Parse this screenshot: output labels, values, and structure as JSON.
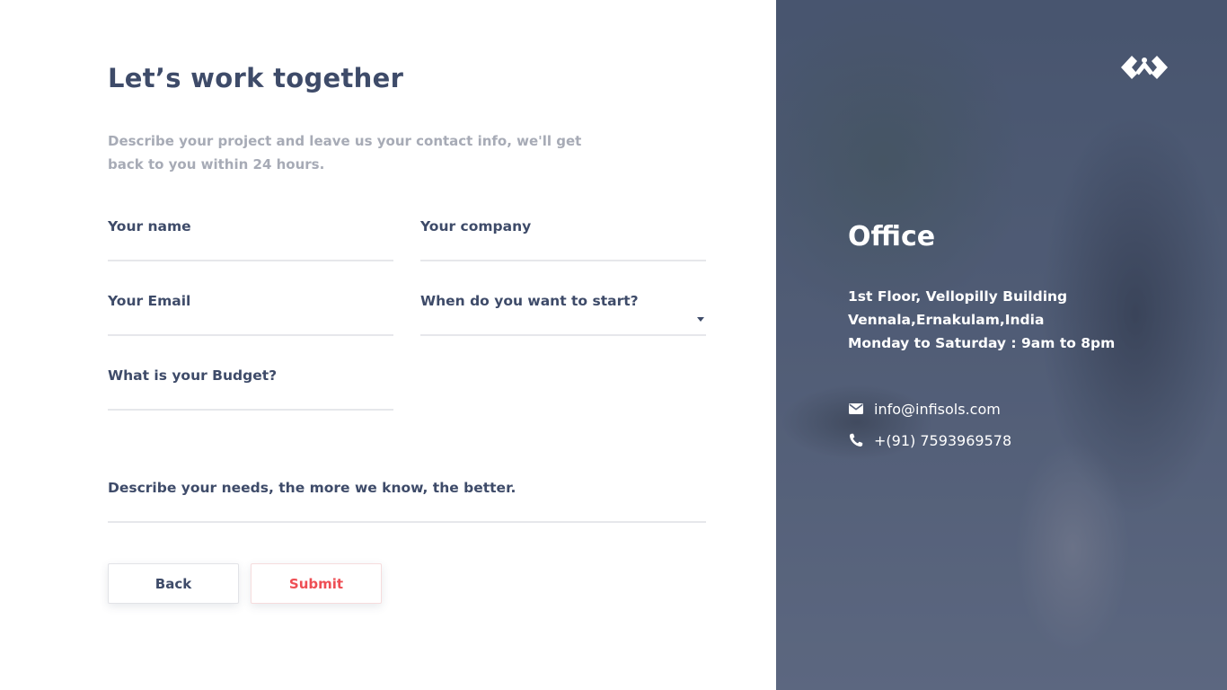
{
  "form": {
    "title": "Let’s work together",
    "subtitle_line1": "Describe your project and leave us your contact info, we'll get",
    "subtitle_line2": "back to you within 24 hours.",
    "fields": {
      "name": "Your name",
      "company": "Your company",
      "email": "Your Email",
      "start": "When do you want to start?",
      "budget": "What is your Budget?",
      "needs": "Describe your needs, the more we know, the better."
    },
    "buttons": {
      "back": "Back",
      "submit": "Submit"
    }
  },
  "office": {
    "heading": "Office",
    "address_line1": "1st Floor, Vellopilly Building",
    "address_line2": "Vennala,Ernakulam,India",
    "hours": "Monday to Saturday : 9am to 8pm",
    "email": "info@infisols.com",
    "phone": "+(91) 7593969578"
  },
  "icons": {
    "mail": "mail-icon",
    "phone": "phone-icon",
    "dropdown": "chevron-down-icon",
    "logo": "infisols-logo"
  },
  "colors": {
    "heading": "#3e4b69",
    "muted": "#a7abb6",
    "accent": "#ee4e54",
    "panel_overlay": "#4a5670"
  }
}
